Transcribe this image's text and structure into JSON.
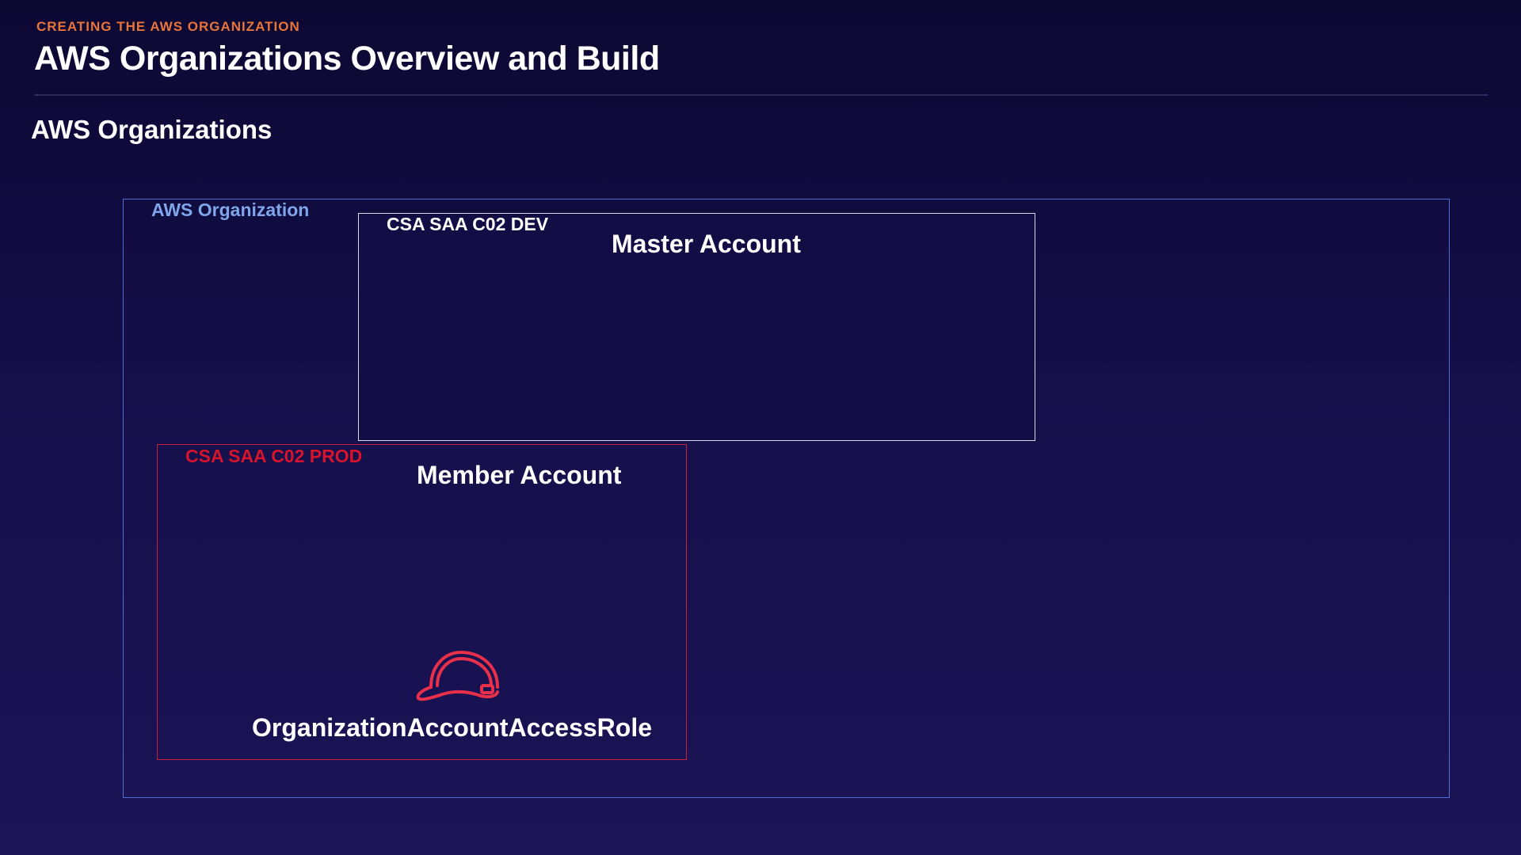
{
  "header": {
    "kicker": "CREATING THE AWS ORGANIZATION",
    "title": "AWS Organizations Overview and Build"
  },
  "section": {
    "heading": "AWS Organizations"
  },
  "diagram": {
    "organization": {
      "label": "AWS Organization",
      "border_color": "#4f6fd6",
      "label_color": "#7fa6ea"
    },
    "master_account": {
      "tag": "CSA SAA C02 DEV",
      "title": "Master Account",
      "border_color": "#d9d9e6"
    },
    "member_account": {
      "tag": "CSA SAA C02 PROD",
      "title": "Member Account",
      "border_color": "#c8203a",
      "tag_color": "#d6142d",
      "role": {
        "icon": "hardhat-icon",
        "label": "OrganizationAccountAccessRole",
        "icon_color": "#e8304a"
      }
    }
  },
  "colors": {
    "accent": "#e8743a",
    "background": "#150f4a"
  }
}
